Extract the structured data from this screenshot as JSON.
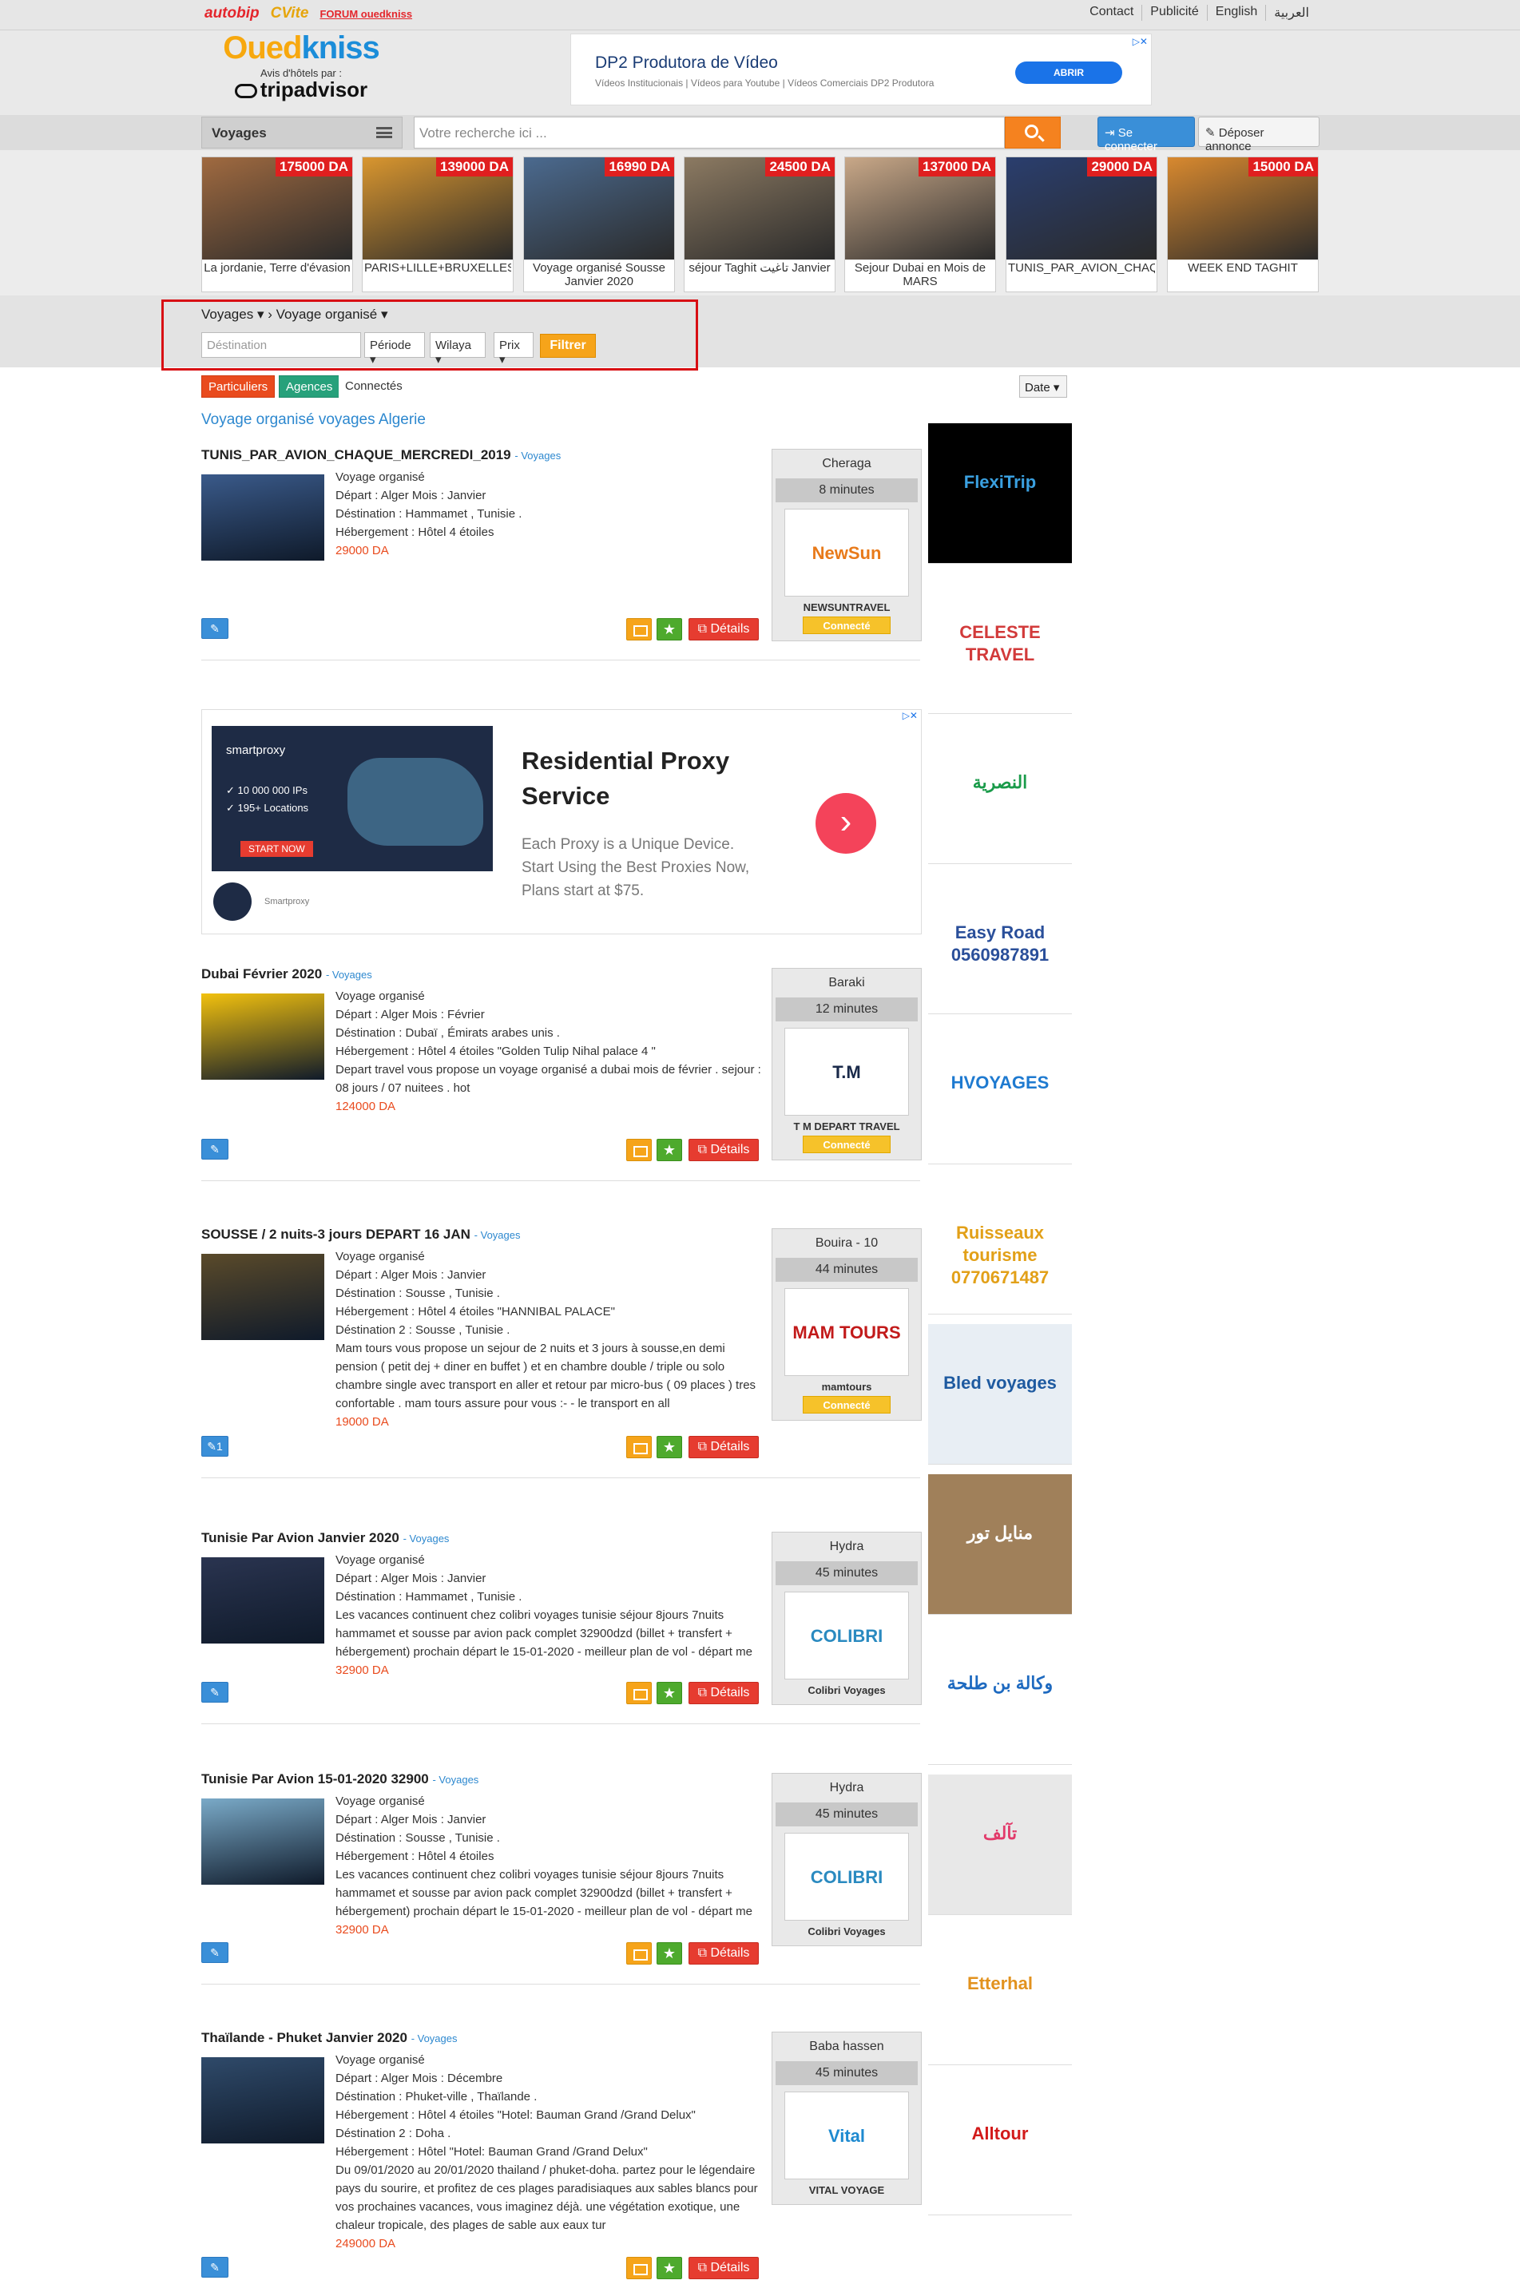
{
  "top": {
    "brands": [
      "autobip",
      "CVite",
      "FORUM ouedkniss"
    ],
    "links": [
      "Contact",
      "Publicité",
      "English",
      "العربية"
    ]
  },
  "header": {
    "logo_oued": "Oued",
    "logo_kniss": "kniss",
    "logo_sub": "Avis d'hôtels par :",
    "logo_ta": "tripadvisor",
    "ad_title": "DP2 Produtora de Vídeo",
    "ad_sub": "Vídeos Institucionais | Vídeos para Youtube | Vídeos Comerciais DP2 Produtora",
    "ad_button": "ABRIR"
  },
  "nav": {
    "category": "Voyages",
    "search_placeholder": "Votre recherche ici ...",
    "login": "Se connecter",
    "deposit": "Déposer annonce"
  },
  "offers": [
    {
      "price": "175000 DA",
      "caption": "La jordanie, Terre d'évasion",
      "color": "#a06a40"
    },
    {
      "price": "139000 DA",
      "caption": "PARIS+LILLE+BRUXELLES+",
      "color": "#d9962f"
    },
    {
      "price": "16990 DA",
      "caption": "Voyage organisé Sousse Janvier 2020",
      "color": "#4b6a8f"
    },
    {
      "price": "24500 DA",
      "caption": "séjour Taghit تاغيت Janvier",
      "color": "#8c7a62"
    },
    {
      "price": "137000 DA",
      "caption": "Sejour Dubai en Mois de MARS",
      "color": "#c9a888"
    },
    {
      "price": "29000 DA",
      "caption": "TUNIS_PAR_AVION_CHAQ",
      "color": "#2a3e6e"
    },
    {
      "price": "15000 DA",
      "caption": "WEEK END TAGHIT",
      "color": "#d8892f"
    }
  ],
  "filter": {
    "crumb1": "Voyages",
    "crumb2": "Voyage organisé",
    "destination_placeholder": "Déstination",
    "periode": "Période",
    "wilaya": "Wilaya",
    "prix": "Prix",
    "button": "Filtrer"
  },
  "tabs": {
    "particuliers": "Particuliers",
    "agences": "Agences",
    "connectes": "Connectés",
    "date": "Date"
  },
  "page_title": "Voyage organisé voyages Algerie",
  "listings": [
    {
      "title": "TUNIS_PAR_AVION_CHAQUE_MERCREDI_2019",
      "cat": "- Voyages",
      "lines": [
        "Voyage organisé",
        "Départ : Alger Mois : Janvier",
        "Déstination : Hammamet , Tunisie .",
        "Hébergement : Hôtel 4 étoiles"
      ],
      "price": "29000 DA",
      "location": "Cheraga",
      "time": "8 minutes",
      "agency": "NEWSUNTRAVEL",
      "connected": "Connecté",
      "edit": "",
      "thumb_color": "#3a5a8a"
    },
    {
      "title": "Dubai Février 2020",
      "cat": "- Voyages",
      "lines": [
        "Voyage organisé",
        "Départ : Alger Mois : Février",
        "Déstination : Dubaï , Émirats arabes unis .",
        "Hébergement : Hôtel 4 étoiles \"Golden Tulip Nihal palace 4 \"",
        "Depart travel vous propose un voyage organisé a dubai mois de février . sejour  :                              08 jours /  07 nuitees .                                         hot"
      ],
      "price": "124000 DA",
      "location": "Baraki",
      "time": "12 minutes",
      "agency": "T M DEPART TRAVEL",
      "connected": "Connecté",
      "edit": "",
      "thumb_color": "#f2c10e"
    },
    {
      "title": "SOUSSE / 2 nuits-3 jours DEPART 16 JAN",
      "cat": "- Voyages",
      "lines": [
        "Voyage organisé",
        "Départ : Alger Mois : Janvier",
        "Déstination : Sousse , Tunisie .",
        "Hébergement : Hôtel 4 étoiles \"HANNIBAL PALACE\"",
        "Déstination 2 : Sousse , Tunisie .",
        "Mam tours vous propose un sejour de 2 nuits et 3 jours à sousse,en demi pension ( petit dej + diner en buffet ) et en chambre double / triple ou solo chambre single avec transport en aller et retour par micro-bus ( 09 places ) tres confortable . mam tours assure pour vous :- - le transport en all"
      ],
      "price": "19000 DA",
      "location": "Bouira - 10",
      "time": "44 minutes",
      "agency": "mamtours",
      "connected": "Connecté",
      "edit": "1",
      "thumb_color": "#5a4a2a"
    },
    {
      "title": "Tunisie Par Avion Janvier 2020",
      "cat": "- Voyages",
      "lines": [
        "Voyage organisé",
        "Départ : Alger Mois : Janvier",
        "Déstination : Hammamet , Tunisie .",
        "Les vacances continuent chez colibri voyages tunisie séjour 8jours 7nuits hammamet et sousse  par avion pack complet 32900dzd (billet + transfert + hébergement) prochain départ le 15-01-2020 - meilleur plan de vol - départ me"
      ],
      "price": "32900 DA",
      "location": "Hydra",
      "time": "45 minutes",
      "agency": "Colibri Voyages",
      "connected": "",
      "edit": "",
      "thumb_color": "#2a3450"
    },
    {
      "title": "Tunisie Par Avion 15-01-2020 32900",
      "cat": "- Voyages",
      "lines": [
        "Voyage organisé",
        "Départ : Alger Mois : Janvier",
        "Déstination : Sousse , Tunisie .",
        "Hébergement : Hôtel 4 étoiles",
        "Les vacances continuent chez colibri voyages tunisie séjour 8jours 7nuits hammamet et sousse  par avion pack complet 32900dzd (billet + transfert + hébergement) prochain départ le 15-01-2020 - meilleur plan de vol - départ me"
      ],
      "price": "32900 DA",
      "location": "Hydra",
      "time": "45 minutes",
      "agency": "Colibri Voyages",
      "connected": "",
      "edit": "",
      "thumb_color": "#7aaac8"
    },
    {
      "title": "Thaïlande - Phuket Janvier 2020",
      "cat": "- Voyages",
      "lines": [
        "Voyage organisé",
        "Départ : Alger Mois : Décembre",
        "Déstination : Phuket-ville , Thaïlande .",
        "Hébergement : Hôtel 4 étoiles \"Hotel: Bauman Grand /Grand Delux\"",
        "Déstination 2 : Doha .",
        "Hébergement : Hôtel \"Hotel: Bauman Grand /Grand Delux\"",
        "Du 09/01/2020 au 20/01/2020 thailand / phuket-doha. partez pour le légendaire pays du sourire, et profitez de ces plages paradisiaques aux sables blancs pour vos prochaines vacances, vous imaginez déjà. une végétation exotique, une chaleur tropicale, des plages de sable aux eaux tur"
      ],
      "price": "249000 DA",
      "location": "Baba hassen",
      "time": "45 minutes",
      "agency": "VITAL VOYAGE",
      "connected": "",
      "edit": "",
      "thumb_color": "#2f4a6a"
    }
  ],
  "midad": {
    "brand": "smartproxy",
    "stat1": "✓ 10 000 000 IPs",
    "stat2": "✓ 195+ Locations",
    "cta": "START NOW",
    "headline1": "Residential Proxy",
    "headline2": "Service",
    "body1": "Each Proxy is a Unique Device.",
    "body2": "Start Using the Best Proxies Now,",
    "body3": "Plans start at $75.",
    "footer": "Smartproxy"
  },
  "sidebar": [
    {
      "text": "FlexiTrip",
      "bg": "#000000",
      "fg": "#3aa0e0"
    },
    {
      "text": "CELESTE TRAVEL",
      "bg": "#ffffff",
      "fg": "#d23a3a"
    },
    {
      "text": "النصرية",
      "bg": "#ffffff",
      "fg": "#1a9b4a"
    },
    {
      "text": "Easy Road 0560987891",
      "bg": "#ffffff",
      "fg": "#2a4f9a"
    },
    {
      "text": "HVOYAGES",
      "bg": "#ffffff",
      "fg": "#1e7ad0"
    },
    {
      "text": "Ruisseaux tourisme 0770671487",
      "bg": "#ffffff",
      "fg": "#e2a018"
    },
    {
      "text": "Bled voyages",
      "bg": "#e8eef4",
      "fg": "#1e5aa0"
    },
    {
      "text": "منايل تور",
      "bg": "#a0805a",
      "fg": "#ffffff"
    },
    {
      "text": "وكالة بن طلحة",
      "bg": "#ffffff",
      "fg": "#1e6ac0"
    },
    {
      "text": "تآلف",
      "bg": "#e8e8e8",
      "fg": "#e23a6a"
    },
    {
      "text": "Etterhal",
      "bg": "#ffffff",
      "fg": "#e2921e"
    },
    {
      "text": "Alltour",
      "bg": "#ffffff",
      "fg": "#d21a1a"
    }
  ]
}
